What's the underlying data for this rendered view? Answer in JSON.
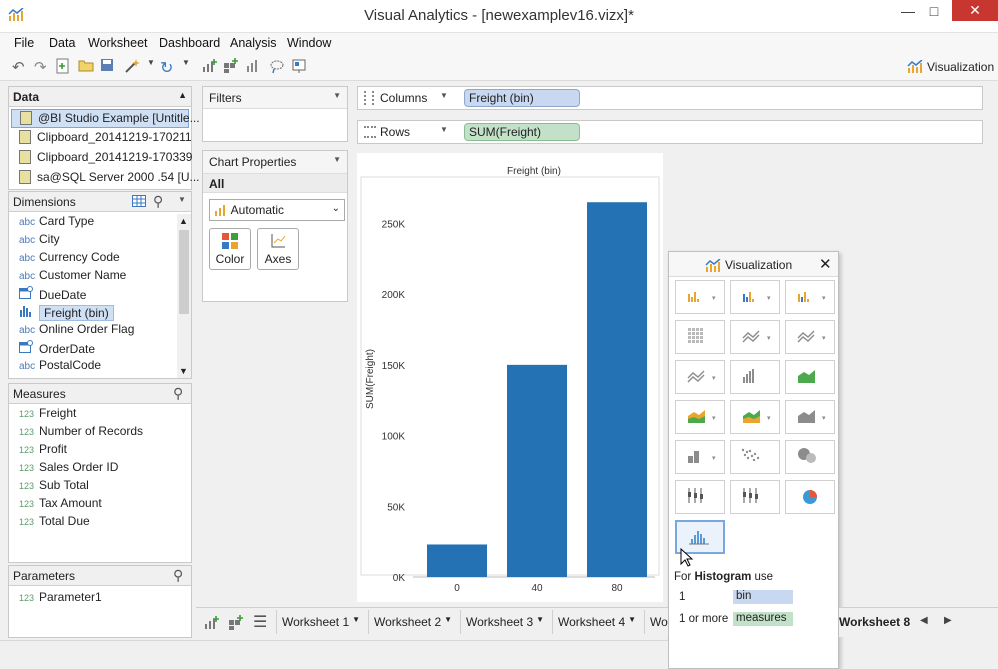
{
  "window": {
    "title": "Visual Analytics - [newexamplev16.vizx]*"
  },
  "menu": [
    "File",
    "Data",
    "Worksheet",
    "Dashboard",
    "Analysis",
    "Window"
  ],
  "toolbar": {
    "viz_label": "Visualization"
  },
  "data_panel": {
    "title": "Data",
    "sources": [
      "@BI Studio Example [Untitle...",
      "Clipboard_20141219-170211",
      "Clipboard_20141219-170339",
      "sa@SQL Server 2000 .54 [U..."
    ]
  },
  "dimensions": {
    "title": "Dimensions",
    "items": [
      {
        "type": "abc",
        "label": "Card Type"
      },
      {
        "type": "abc",
        "label": "City"
      },
      {
        "type": "abc",
        "label": "Currency Code"
      },
      {
        "type": "abc",
        "label": "Customer Name"
      },
      {
        "type": "date",
        "label": "DueDate"
      },
      {
        "type": "bin",
        "label": "Freight (bin)"
      },
      {
        "type": "abc",
        "label": "Online Order Flag"
      },
      {
        "type": "date",
        "label": "OrderDate"
      },
      {
        "type": "abc",
        "label": "PostalCode"
      }
    ]
  },
  "measures": {
    "title": "Measures",
    "items": [
      "Freight",
      "Number of Records",
      "Profit",
      "Sales Order ID",
      "Sub Total",
      "Tax Amount",
      "Total Due"
    ],
    "type_label": "123"
  },
  "parameters": {
    "title": "Parameters",
    "items": [
      "Parameter1"
    ]
  },
  "filters": {
    "title": "Filters"
  },
  "chart_properties": {
    "title": "Chart Properties",
    "scope": "All",
    "mark_type": "Automatic",
    "buttons": [
      "Color",
      "Axes"
    ]
  },
  "shelves": {
    "columns_label": "Columns",
    "columns_pill": "Freight (bin)",
    "rows_label": "Rows",
    "rows_pill": "SUM(Freight)"
  },
  "chart_data": {
    "type": "bar",
    "title": "Freight (bin)",
    "ylabel": "SUM(Freight)",
    "categories": [
      "0",
      "40",
      "80"
    ],
    "values": [
      23000,
      150000,
      265000
    ],
    "ylim": [
      0,
      280000
    ],
    "yticks": [
      0,
      50000,
      100000,
      150000,
      200000,
      250000
    ],
    "ytick_labels": [
      "0K",
      "50K",
      "100K",
      "150K",
      "200K",
      "250K"
    ],
    "bar_color": "#2472b4"
  },
  "viz_popup": {
    "title": "Visualization",
    "hint_prefix": "For",
    "hint_type": "Histogram",
    "hint_suffix": "use",
    "req1_count": "1",
    "req1_field": "bin",
    "req2_count": "1 or more",
    "req2_field": "measures"
  },
  "tabs": [
    "Worksheet 1",
    "Worksheet 2",
    "Worksheet 3",
    "Worksheet 4",
    "Wor",
    "Worksheet 8"
  ]
}
